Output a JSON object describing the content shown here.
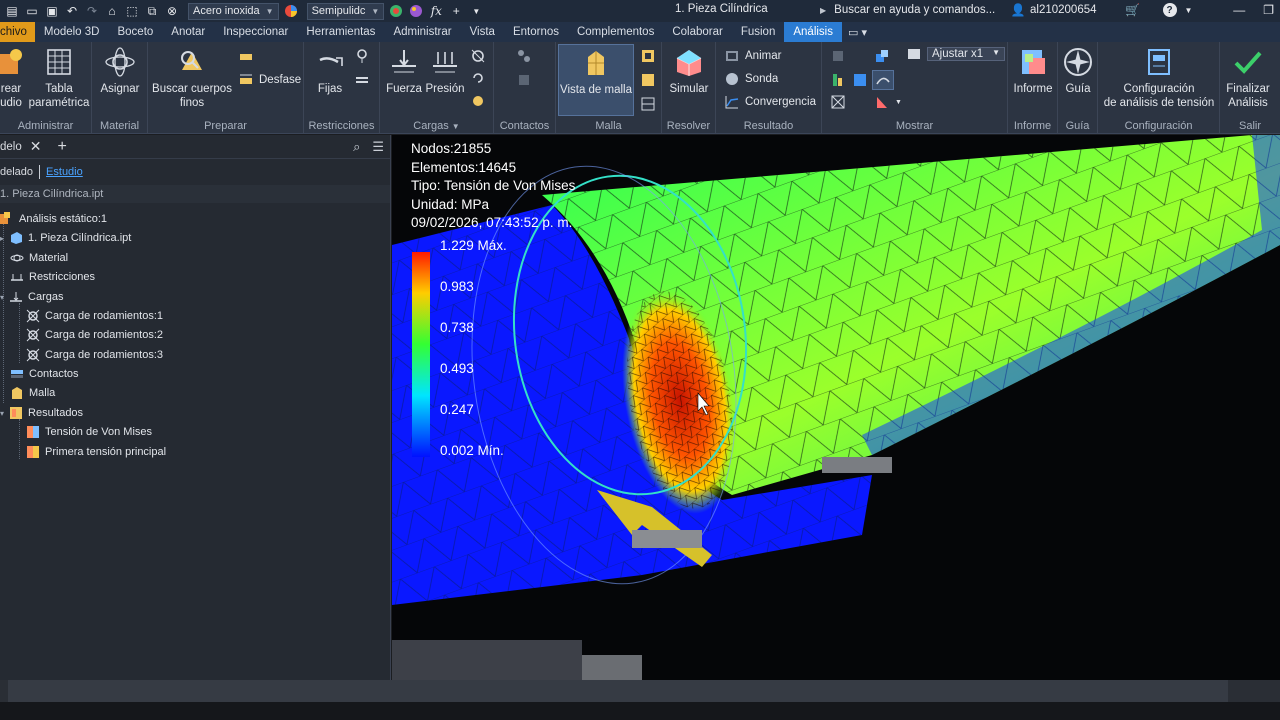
{
  "titlebar": {
    "material_select": "Acero inoxida",
    "appearance_select": "Semipulidc",
    "fx_label": "fx",
    "document_title": "1. Pieza Cilíndrica",
    "help_search": "Buscar en ayuda y comandos...",
    "username": "al210200654"
  },
  "tabs": [
    {
      "label": "chivo"
    },
    {
      "label": "Modelo 3D"
    },
    {
      "label": "Boceto"
    },
    {
      "label": "Anotar"
    },
    {
      "label": "Inspeccionar"
    },
    {
      "label": "Herramientas"
    },
    {
      "label": "Administrar"
    },
    {
      "label": "Vista"
    },
    {
      "label": "Entornos"
    },
    {
      "label": "Complementos"
    },
    {
      "label": "Colaborar"
    },
    {
      "label": "Fusion"
    },
    {
      "label": "Análisis"
    }
  ],
  "ribbon": {
    "administrar": {
      "label": "Administrar",
      "crear_line1": "rear",
      "crear_line2": "udio",
      "tabla_line1": "Tabla",
      "tabla_line2": "paramétrica"
    },
    "material": {
      "label": "Material",
      "asignar": "Asignar"
    },
    "preparar": {
      "label": "Preparar",
      "buscar_line1": "Buscar cuerpos",
      "buscar_line2": "finos",
      "desfase": "Desfase"
    },
    "restricciones": {
      "label": "Restricciones",
      "fijas": "Fijas"
    },
    "cargas": {
      "label": "Cargas",
      "fuerza": "Fuerza",
      "presion": "Presión"
    },
    "contactos": {
      "label": "Contactos"
    },
    "malla": {
      "label": "Malla",
      "vista": "Vista de malla"
    },
    "resolver": {
      "label": "Resolver",
      "simular": "Simular"
    },
    "resultado": {
      "label": "Resultado",
      "animar": "Animar",
      "sonda": "Sonda",
      "convergencia": "Convergencia"
    },
    "mostrar": {
      "label": "Mostrar",
      "ajustar": "Ajustar x1"
    },
    "informe": {
      "label": "Informe",
      "informe": "Informe"
    },
    "guia": {
      "label": "Guía",
      "guia": "Guía"
    },
    "configuracion": {
      "label": "Configuración",
      "line1": "Configuración",
      "line2": "de análisis de tensión"
    },
    "salir": {
      "label": "Salir",
      "line1": "Finalizar",
      "line2": "Análisis"
    }
  },
  "browser": {
    "tab_label": "delo",
    "sub_modelado": "delado",
    "sub_estudio": "Estudio",
    "file_row": "1. Pieza Cilíndrica.ipt",
    "tree": [
      {
        "label": "Análisis estático:1"
      },
      {
        "label": "1. Pieza Cilíndrica.ipt"
      },
      {
        "label": "Material"
      },
      {
        "label": "Restricciones"
      },
      {
        "label": "Cargas"
      },
      {
        "label": "Carga de rodamientos:1"
      },
      {
        "label": "Carga de rodamientos:2"
      },
      {
        "label": "Carga de rodamientos:3"
      },
      {
        "label": "Contactos"
      },
      {
        "label": "Malla"
      },
      {
        "label": "Resultados"
      },
      {
        "label": "Tensión de Von Mises"
      },
      {
        "label": "Primera tensión principal"
      }
    ]
  },
  "viewport": {
    "nodes": "Nodos:21855",
    "elements": "Elementos:14645",
    "type": "Tipo: Tensión de Von Mises",
    "unit": "Unidad: MPa",
    "timestamp": "09/02/2026, 07:43:52 p. m.",
    "legend": {
      "max": "1.229 Máx.",
      "v1": "0.983",
      "v2": "0.738",
      "v3": "0.493",
      "v4": "0.247",
      "min": "0.002 Mín."
    }
  },
  "colors": {
    "accent": "#2b7cd3",
    "file_tab": "#e19a1a",
    "ribbon_bg": "#2c3442",
    "stress_low": "#0a1cff",
    "stress_mid": "#22ff22",
    "stress_high": "#ff2200"
  }
}
